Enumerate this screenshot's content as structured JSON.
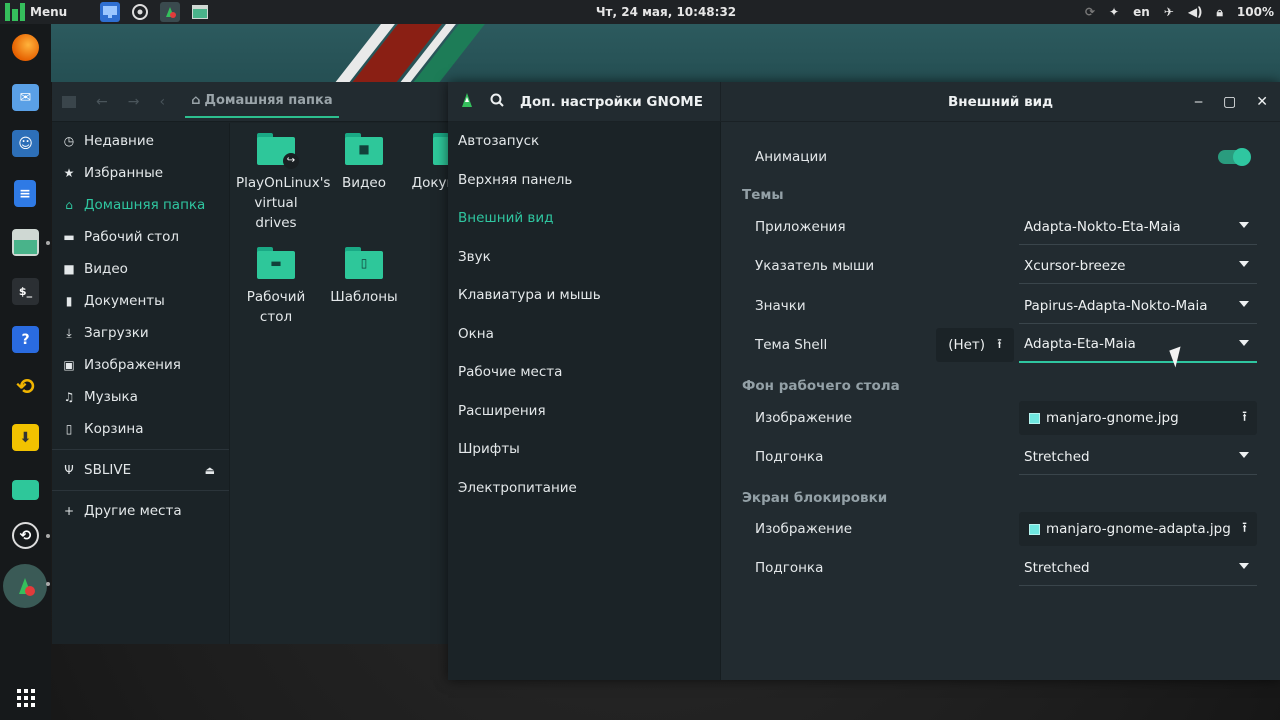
{
  "topbar": {
    "menu_label": "Menu",
    "clock": "Чт, 24 мая, 10:48:32",
    "lang": "en",
    "battery": "100%",
    "quick_icons": [
      "desktop-icon",
      "browser-icon",
      "tweaks-icon",
      "files-icon"
    ],
    "tray_icons": [
      "sync-icon",
      "accessibility-icon",
      "airplane-icon",
      "volume-icon",
      "lock-icon"
    ]
  },
  "dock": {
    "apps": [
      "firefox-icon",
      "mail-icon",
      "chat-icon",
      "document-editor-icon",
      "files-manager-icon",
      "terminal-icon",
      "help-icon",
      "update-icon",
      "download-icon",
      "folder-icon",
      "settings-icon",
      "gnome-tweaks-icon",
      "app-grid-icon"
    ]
  },
  "files": {
    "breadcrumb": "Домашняя папка",
    "places": [
      {
        "label": "Недавние",
        "icon": "clock-icon"
      },
      {
        "label": "Избранные",
        "icon": "star-icon"
      },
      {
        "label": "Домашняя папка",
        "icon": "home-icon",
        "active": true
      },
      {
        "label": "Рабочий стол",
        "icon": "desktop-icon"
      },
      {
        "label": "Видео",
        "icon": "video-icon"
      },
      {
        "label": "Документы",
        "icon": "document-icon"
      },
      {
        "label": "Загрузки",
        "icon": "download-icon"
      },
      {
        "label": "Изображения",
        "icon": "image-icon"
      },
      {
        "label": "Музыка",
        "icon": "music-icon"
      },
      {
        "label": "Корзина",
        "icon": "trash-icon"
      }
    ],
    "device": "SBLIVE",
    "other_places": "Другие места",
    "items": [
      {
        "label": "PlayOnLinux's virtual drives",
        "icon": "shared-folder-icon"
      },
      {
        "label": "Видео",
        "icon": "video-folder-icon"
      },
      {
        "label": "Документы",
        "icon": "documents-folder-icon"
      },
      {
        "label": "Рабочий стол",
        "icon": "desktop-folder-icon"
      },
      {
        "label": "Шаблоны",
        "icon": "templates-folder-icon"
      }
    ]
  },
  "tweaks": {
    "app_title": "Доп. настройки GNOME",
    "page_title": "Внешний вид",
    "sidebar": [
      "Автозапуск",
      "Верхняя панель",
      "Внешний вид",
      "Звук",
      "Клавиатура и мышь",
      "Окна",
      "Рабочие места",
      "Расширения",
      "Шрифты",
      "Электропитание"
    ],
    "active_section": "Внешний вид",
    "animations_label": "Анимации",
    "animations_on": true,
    "themes_header": "Темы",
    "apps_label": "Приложения",
    "apps_value": "Adapta-Nokto-Eta-Maia",
    "cursor_label": "Указатель мыши",
    "cursor_value": "Xcursor-breeze",
    "icons_label": "Значки",
    "icons_value": "Papirus-Adapta-Nokto-Maia",
    "shell_label": "Тема Shell",
    "shell_none": "(Нет)",
    "shell_value": "Adapta-Eta-Maia",
    "background_header": "Фон рабочего стола",
    "bg_image_label": "Изображение",
    "bg_image_value": "manjaro-gnome.jpg",
    "bg_fit_label": "Подгонка",
    "bg_fit_value": "Stretched",
    "lock_header": "Экран блокировки",
    "lock_image_label": "Изображение",
    "lock_image_value": "manjaro-gnome-adapta.jpg",
    "lock_fit_label": "Подгонка",
    "lock_fit_value": "Stretched"
  },
  "colors": {
    "accent": "#2fc6a0",
    "panel_bg": "#222b30",
    "sidebar_bg": "#1b2327",
    "folder": "#2ec79a"
  }
}
